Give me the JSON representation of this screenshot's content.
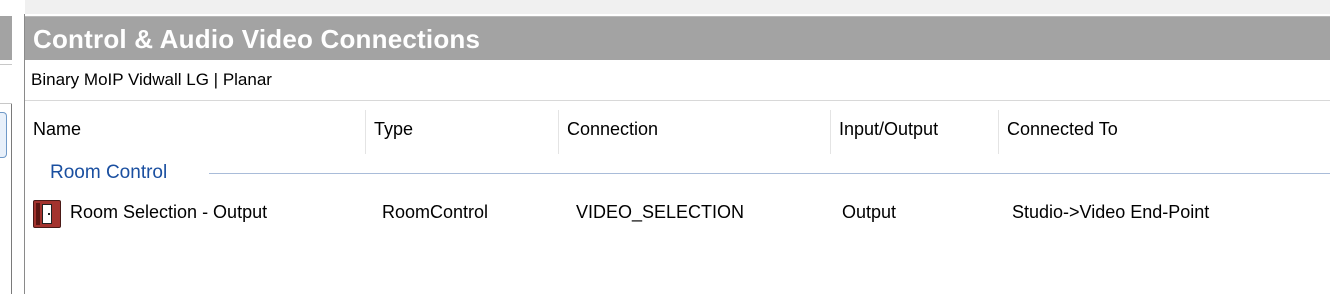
{
  "panel": {
    "title": "Control & Audio Video Connections",
    "device": "Binary MoIP Vidwall LG | Planar"
  },
  "columns": [
    "Name",
    "Type",
    "Connection",
    "Input/Output",
    "Connected To"
  ],
  "groups": [
    {
      "label": "Room Control",
      "rows": [
        {
          "icon": "room-door-icon",
          "name": "Room Selection - Output",
          "type": "RoomControl",
          "connection": "VIDEO_SELECTION",
          "io": "Output",
          "connected_to": "Studio->Video End-Point"
        }
      ]
    }
  ],
  "colors": {
    "title_bar": "#a3a3a3",
    "group_label": "#1a4fa0",
    "icon": "#a3332e"
  }
}
